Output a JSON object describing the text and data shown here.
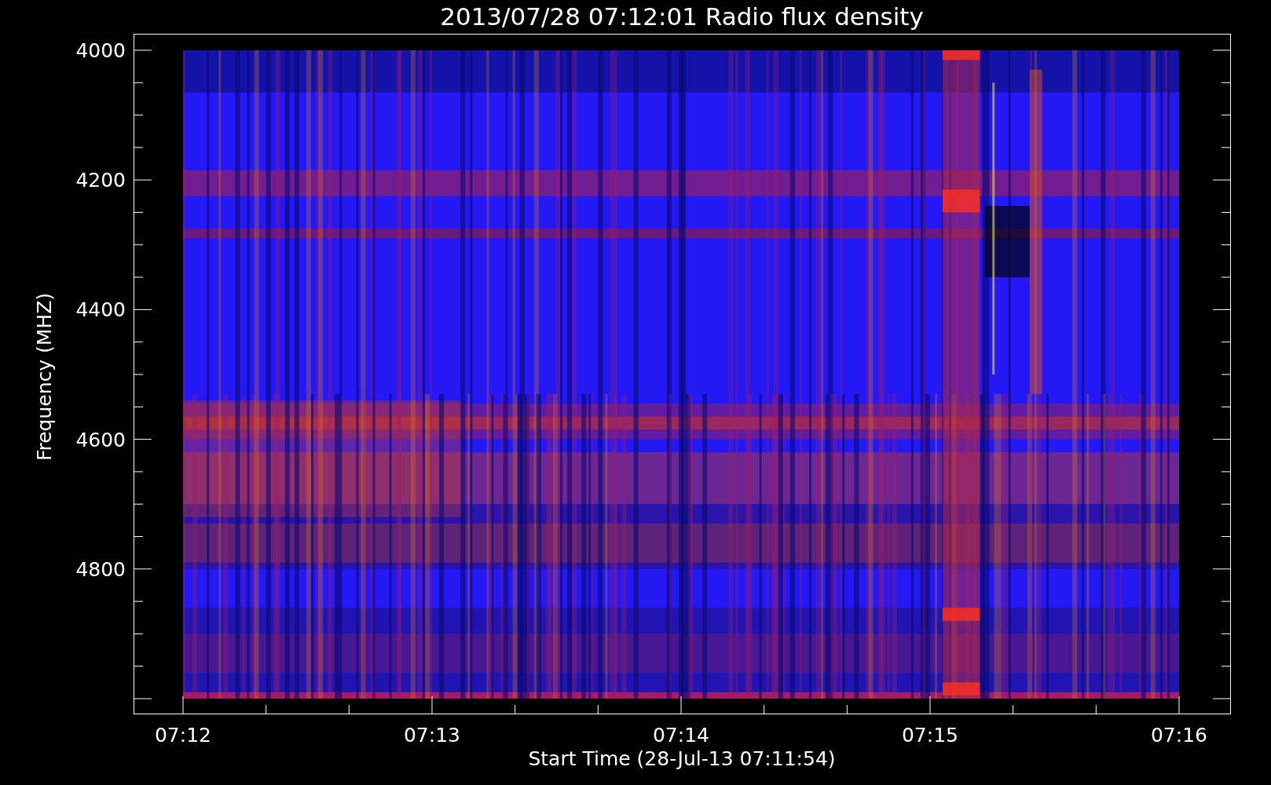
{
  "title": "2013/07/28 07:12:01 Radio flux density",
  "y_axis": {
    "label": "Frequency (MHZ)",
    "ticks": [
      "4000",
      "4200",
      "4400",
      "4600",
      "4800"
    ]
  },
  "x_axis": {
    "label": "Start Time (28-Jul-13 07:11:54)",
    "ticks": [
      "07:12",
      "07:13",
      "07:14",
      "07:15",
      "07:16"
    ]
  }
}
